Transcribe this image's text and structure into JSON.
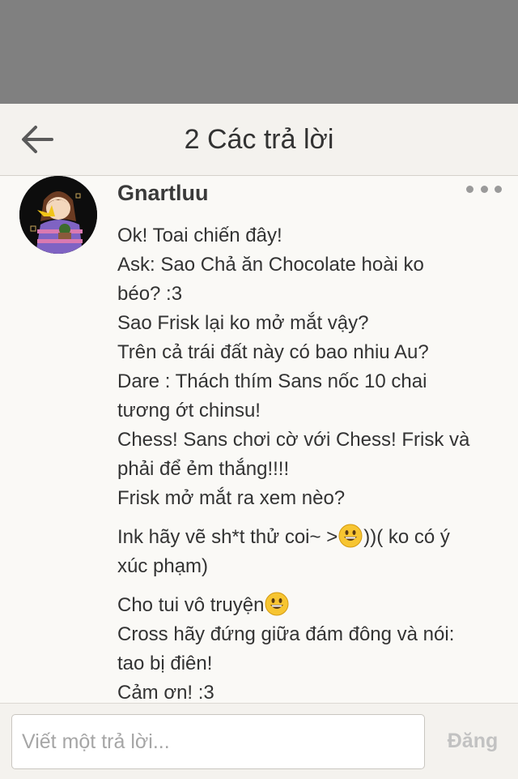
{
  "header": {
    "title": "2 Các trả lời"
  },
  "post": {
    "username": "Gnartluu",
    "paragraphs": [
      {
        "lines": [
          "Ok! Toai chiến đây!",
          "Ask: Sao Chả ăn Chocolate hoài ko",
          "béo? :3",
          "Sao Frisk lại ko mở mắt vậy?",
          "Trên cả trái đất này có bao nhiu Au?",
          "Dare : Thách thím Sans nốc 10 chai",
          "tương ớt chinsu!",
          "Chess! Sans chơi cờ với Chess! Frisk và",
          "phải để ẻm thắng!!!!",
          "Frisk mở mắt ra xem nèo?"
        ]
      },
      {
        "line1_before": "Ink hãy vẽ sh*t thử coi~ >",
        "line1_after": "))( ko có ý",
        "line2": "xúc phạm)"
      },
      {
        "line1_before": "Cho tui vô truyện",
        "lines": [
          "Cross hãy đứng giữa đám đông và nói:",
          "tao bị điên!",
          "Cảm ơn! :3"
        ]
      }
    ]
  },
  "composer": {
    "placeholder": "Viết một trả lời...",
    "send_label": "Đăng"
  },
  "icons": {
    "back": "arrow-left-icon",
    "more": "more-dots-icon",
    "emoji": "grinning-face-emoji"
  }
}
